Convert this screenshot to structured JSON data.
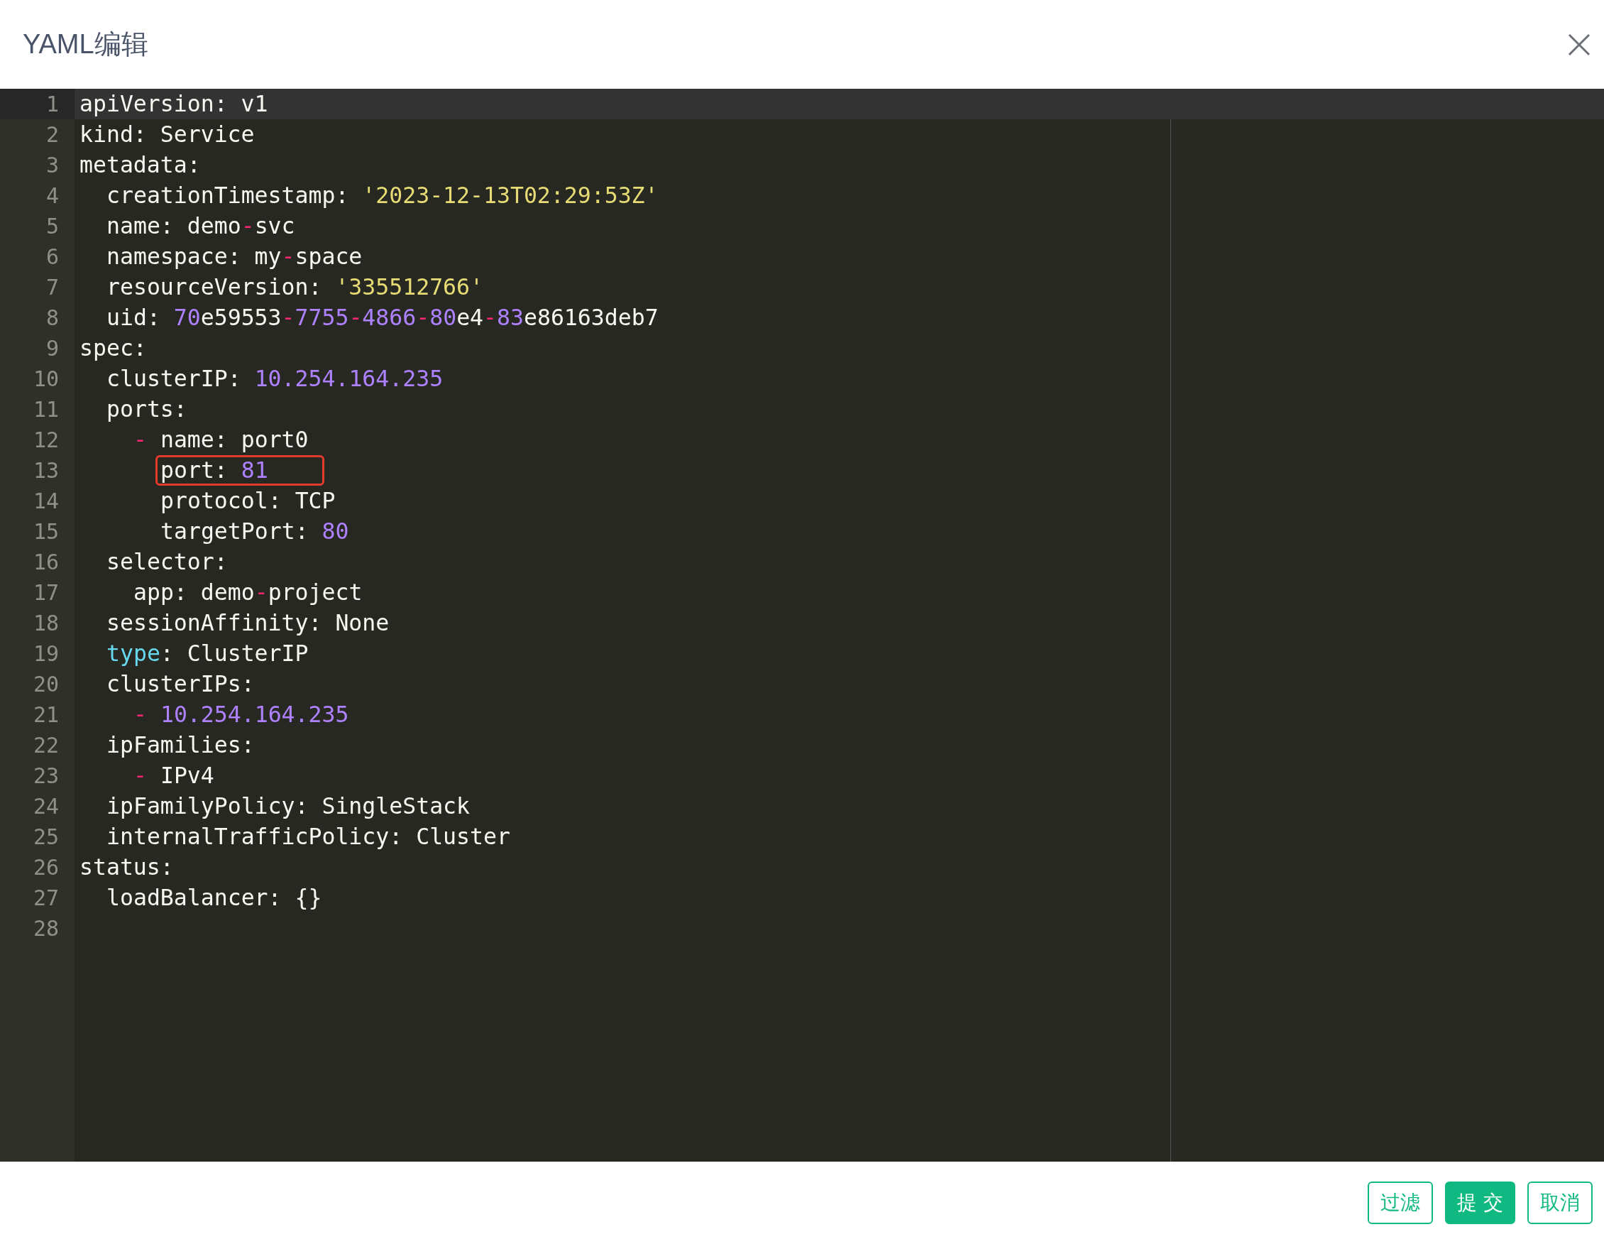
{
  "dialog": {
    "title": "YAML编辑"
  },
  "editor": {
    "lines": [
      {
        "number": "1",
        "active": true,
        "tokens": [
          {
            "text": "apiVersion: v1",
            "kind": "plain"
          }
        ]
      },
      {
        "number": "2",
        "active": false,
        "tokens": [
          {
            "text": "kind: Service",
            "kind": "plain"
          }
        ]
      },
      {
        "number": "3",
        "active": false,
        "tokens": [
          {
            "text": "metadata:",
            "kind": "plain"
          }
        ],
        "children": [
          {
            "number": "4",
            "active": false,
            "tokens": [
              {
                "text": "creationTimestamp: ",
                "kind": "plain"
              },
              {
                "text": "'2023-12-13T02:29:53Z'",
                "kind": "string"
              }
            ]
          },
          {
            "number": "5",
            "active": false,
            "tokens": [
              {
                "text": "name: demo",
                "kind": "plain"
              },
              {
                "text": "-",
                "kind": "dash"
              },
              {
                "text": "svc",
                "kind": "plain"
              }
            ]
          },
          {
            "number": "6",
            "active": false,
            "tokens": [
              {
                "text": "namespace: my",
                "kind": "plain"
              },
              {
                "text": "-",
                "kind": "dash"
              },
              {
                "text": "space",
                "kind": "plain"
              }
            ]
          },
          {
            "number": "7",
            "active": false,
            "tokens": [
              {
                "text": "resourceVersion: ",
                "kind": "plain"
              },
              {
                "text": "'335512766'",
                "kind": "string"
              }
            ]
          },
          {
            "number": "8",
            "active": false,
            "tokens": [
              {
                "text": "uid: ",
                "kind": "plain"
              },
              {
                "text": "70",
                "kind": "number"
              },
              {
                "text": "e59553",
                "kind": "plain"
              },
              {
                "text": "-",
                "kind": "dash"
              },
              {
                "text": "7755",
                "kind": "number"
              },
              {
                "text": "-",
                "kind": "dash"
              },
              {
                "text": "4866",
                "kind": "number"
              },
              {
                "text": "-",
                "kind": "dash"
              },
              {
                "text": "80",
                "kind": "number"
              },
              {
                "text": "e4",
                "kind": "plain"
              },
              {
                "text": "-",
                "kind": "dash"
              },
              {
                "text": "83",
                "kind": "number"
              },
              {
                "text": "e86163deb7",
                "kind": "plain"
              }
            ]
          }
        ]
      },
      {
        "number": "9",
        "active": false,
        "tokens": [
          {
            "text": "spec:",
            "kind": "plain"
          }
        ],
        "children": [
          {
            "number": "10",
            "active": false,
            "tokens": [
              {
                "text": "clusterIP: ",
                "kind": "plain"
              },
              {
                "text": "10.254.164.235",
                "kind": "number"
              }
            ]
          },
          {
            "number": "11",
            "active": false,
            "tokens": [
              {
                "text": "ports:",
                "kind": "plain"
              }
            ],
            "children": [
              {
                "number": "12",
                "active": false,
                "tokens": [
                  {
                    "text": "- ",
                    "kind": "dash"
                  },
                  {
                    "text": "name: port0",
                    "kind": "plain"
                  }
                ],
                "children": [
                  {
                    "number": "13",
                    "active": false,
                    "tokens": [
                      {
                        "text": "port: ",
                        "kind": "plain",
                        "boxed": true
                      },
                      {
                        "text": "81",
                        "kind": "number",
                        "boxed": true
                      }
                    ]
                  },
                  {
                    "number": "14",
                    "active": false,
                    "tokens": [
                      {
                        "text": "protocol: TCP",
                        "kind": "plain"
                      }
                    ]
                  },
                  {
                    "number": "15",
                    "active": false,
                    "tokens": [
                      {
                        "text": "targetPort: ",
                        "kind": "plain"
                      },
                      {
                        "text": "80",
                        "kind": "number"
                      }
                    ]
                  }
                ]
              }
            ]
          },
          {
            "number": "16",
            "active": false,
            "tokens": [
              {
                "text": "selector:",
                "kind": "plain"
              }
            ],
            "children": [
              {
                "number": "17",
                "active": false,
                "tokens": [
                  {
                    "text": "app: demo",
                    "kind": "plain"
                  },
                  {
                    "text": "-",
                    "kind": "dash"
                  },
                  {
                    "text": "project",
                    "kind": "plain"
                  }
                ]
              }
            ]
          },
          {
            "number": "18",
            "active": false,
            "tokens": [
              {
                "text": "sessionAffinity: None",
                "kind": "plain"
              }
            ]
          },
          {
            "number": "19",
            "active": false,
            "tokens": [
              {
                "text": "type",
                "kind": "keyword"
              },
              {
                "text": ": ClusterIP",
                "kind": "plain"
              }
            ]
          },
          {
            "number": "20",
            "active": false,
            "tokens": [
              {
                "text": "clusterIPs:",
                "kind": "plain"
              }
            ],
            "children": [
              {
                "number": "21",
                "active": false,
                "tokens": [
                  {
                    "text": "- ",
                    "kind": "dash"
                  },
                  {
                    "text": "10.254.164.235",
                    "kind": "number"
                  }
                ]
              }
            ]
          },
          {
            "number": "22",
            "active": false,
            "tokens": [
              {
                "text": "ipFamilies:",
                "kind": "plain"
              }
            ],
            "children": [
              {
                "number": "23",
                "active": false,
                "tokens": [
                  {
                    "text": "- ",
                    "kind": "dash"
                  },
                  {
                    "text": "IPv4",
                    "kind": "plain"
                  }
                ]
              }
            ]
          },
          {
            "number": "24",
            "active": false,
            "tokens": [
              {
                "text": "ipFamilyPolicy: SingleStack",
                "kind": "plain"
              }
            ]
          },
          {
            "number": "25",
            "active": false,
            "tokens": [
              {
                "text": "internalTrafficPolicy: Cluster",
                "kind": "plain"
              }
            ]
          }
        ]
      },
      {
        "number": "26",
        "active": false,
        "tokens": [
          {
            "text": "status:",
            "kind": "plain"
          }
        ],
        "children": [
          {
            "number": "27",
            "active": false,
            "tokens": [
              {
                "text": "loadBalancer: {}",
                "kind": "plain"
              }
            ]
          }
        ]
      },
      {
        "number": "28",
        "active": false
      }
    ]
  },
  "buttons": [
    {
      "label": "过滤",
      "kind": "outline"
    },
    {
      "label": "提 交",
      "kind": "primary"
    },
    {
      "label": "取消",
      "kind": "outline"
    }
  ]
}
